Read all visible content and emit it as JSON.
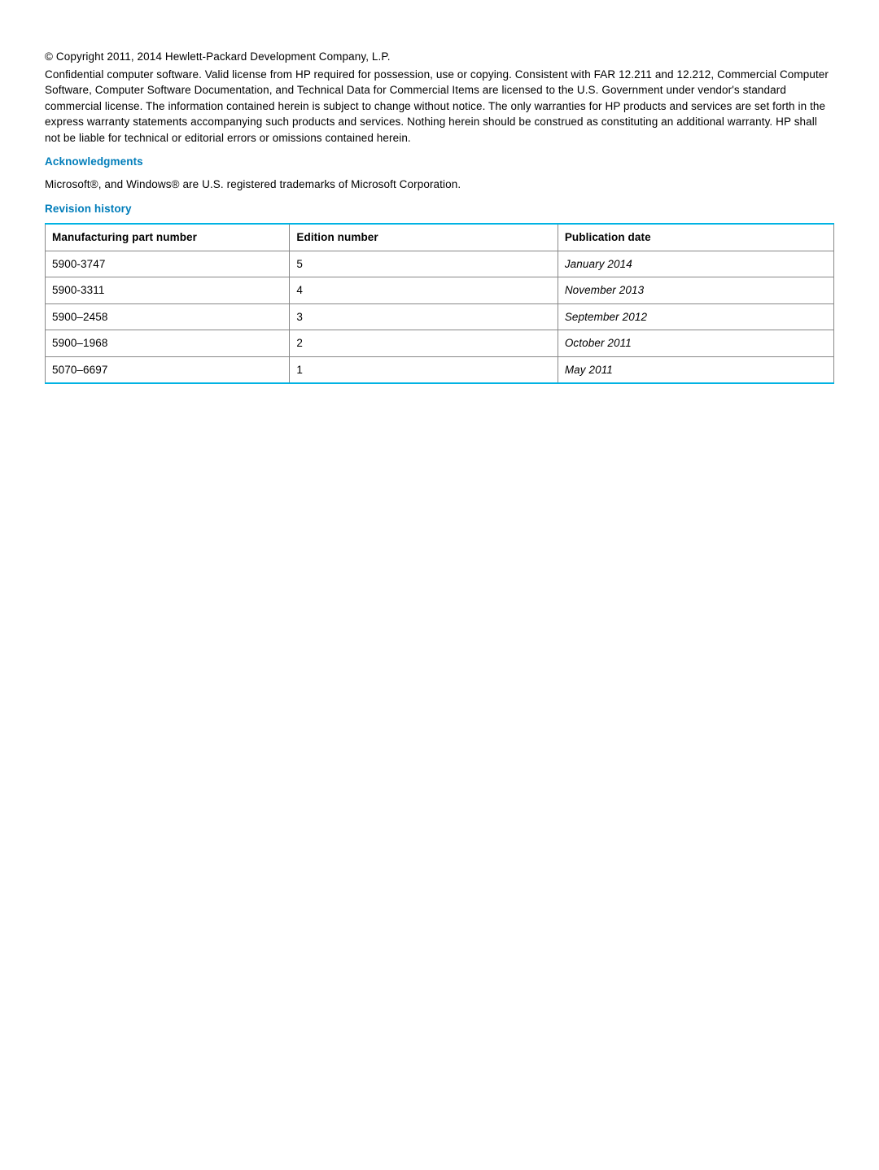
{
  "copyright": "© Copyright 2011, 2014 Hewlett-Packard Development Company, L.P.",
  "legal": "Confidential computer software. Valid license from HP required for possession, use or copying. Consistent with FAR 12.211 and 12.212, Commercial Computer Software, Computer Software Documentation, and Technical Data for Commercial Items are licensed to the U.S. Government under vendor's standard commercial license. The information contained herein is subject to change without notice. The only warranties for HP products and services are set forth in the express warranty statements accompanying such products and services. Nothing herein should be construed as constituting an additional warranty. HP shall not be liable for technical or editorial errors or omissions contained herein.",
  "ack_heading": "Acknowledgments",
  "ack_text": "Microsoft®, and Windows® are U.S. registered trademarks of Microsoft Corporation.",
  "rev_heading": "Revision history",
  "table": {
    "headers": {
      "col1": "Manufacturing part number",
      "col2": "Edition number",
      "col3": "Publication date"
    },
    "rows": [
      {
        "part": "5900-3747",
        "edition": "5",
        "date": "January 2014"
      },
      {
        "part": "5900-3311",
        "edition": "4",
        "date": "November 2013"
      },
      {
        "part": "5900–2458",
        "edition": "3",
        "date": "September 2012"
      },
      {
        "part": "5900–1968",
        "edition": "2",
        "date": "October 2011"
      },
      {
        "part": "5070–6697",
        "edition": "1",
        "date": "May 2011"
      }
    ]
  }
}
